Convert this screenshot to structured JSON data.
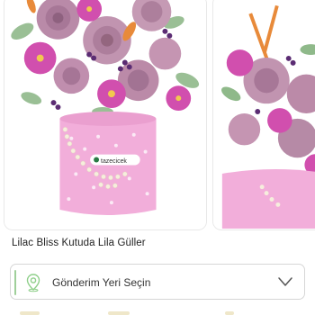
{
  "product": {
    "name": "Lilac Bliss Kutuda Lila Güller",
    "box_label": "tazecicek"
  },
  "location": {
    "label": "Gönderim Yeri Seçin",
    "icon": "location-pin-icon",
    "chevron_icon": "chevron-down-icon"
  },
  "colors": {
    "box_pink": "#f2aeda",
    "accent_green": "#8fcf8a",
    "text": "#222222"
  }
}
